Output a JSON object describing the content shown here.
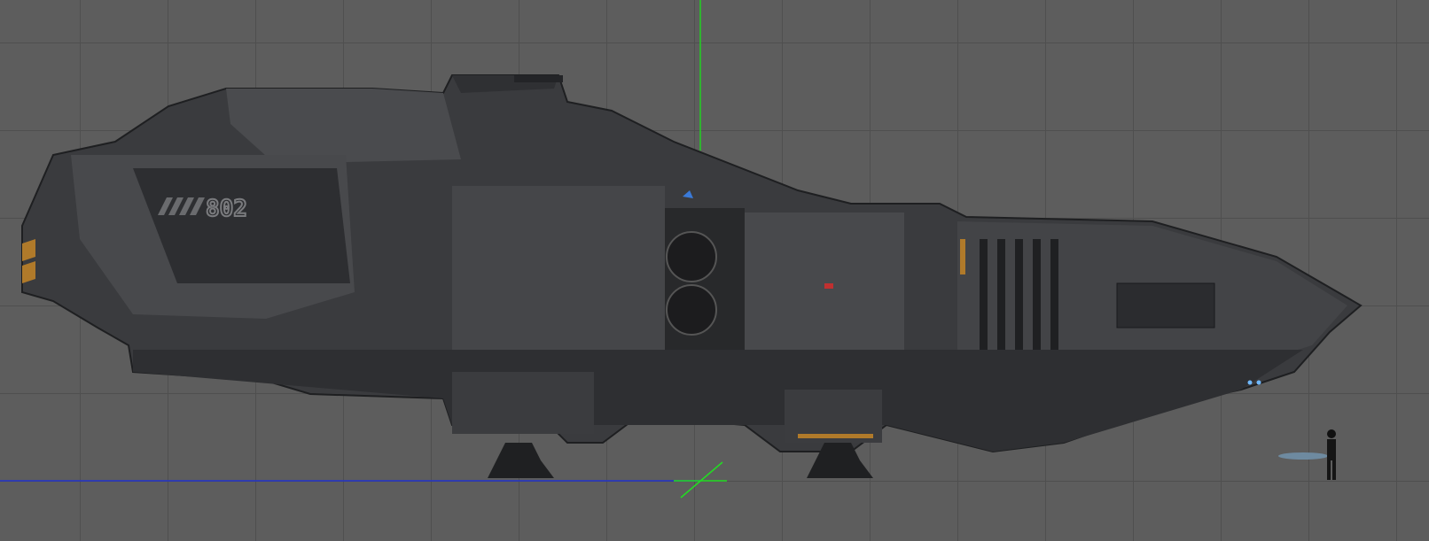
{
  "viewport": {
    "hull_marking": "802",
    "colors": {
      "background": "#5d5d5d",
      "grid": "#4f4f4f",
      "y_axis": "#22d022",
      "x_axis": "#2233cc",
      "hull": "#3c3d40",
      "hazard": "#b07a2a"
    }
  }
}
